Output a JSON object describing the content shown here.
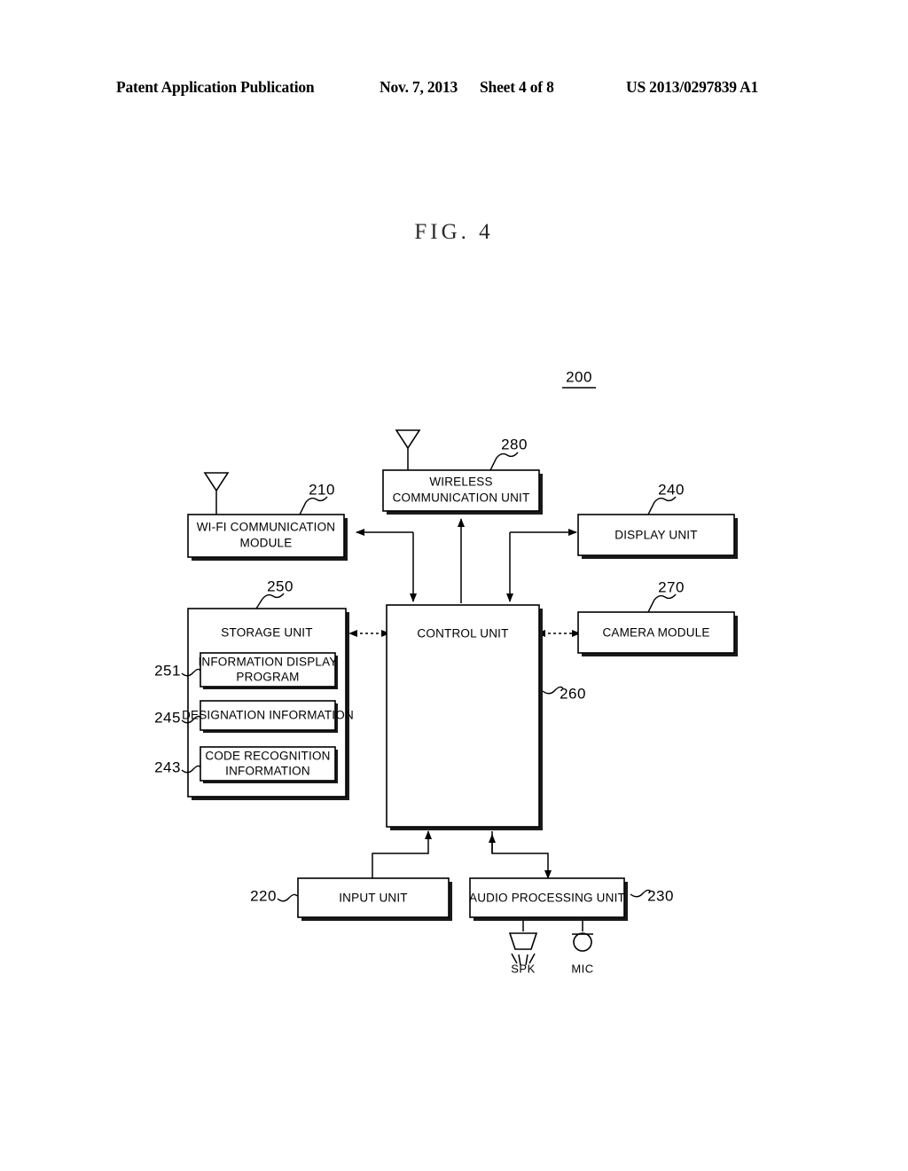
{
  "header": {
    "publication": "Patent Application Publication",
    "date": "Nov. 7, 2013",
    "sheet": "Sheet 4 of 8",
    "patent_number": "US 2013/0297839 A1"
  },
  "figure": {
    "title": "FIG. 4",
    "system_ref": "200"
  },
  "blocks": {
    "wifi": {
      "label_line1": "WI-FI COMMUNICATION",
      "label_line2": "MODULE",
      "ref": "210"
    },
    "wireless": {
      "label_line1": "WIRELESS",
      "label_line2": "COMMUNICATION UNIT",
      "ref": "280"
    },
    "display": {
      "label": "DISPLAY UNIT",
      "ref": "240"
    },
    "storage": {
      "label": "STORAGE UNIT",
      "ref": "250"
    },
    "control": {
      "label": "CONTROL UNIT",
      "ref": "260"
    },
    "camera": {
      "label": "CAMERA MODULE",
      "ref": "270"
    },
    "input": {
      "label": "INPUT UNIT",
      "ref": "220"
    },
    "audio": {
      "label": "AUDIO PROCESSING UNIT",
      "ref": "230"
    }
  },
  "storage_items": [
    {
      "label_line1": "INFORMATION DISPLAY",
      "label_line2": "PROGRAM",
      "ref": "251"
    },
    {
      "label_line1": "DESIGNATION INFORMATION",
      "label_line2": "",
      "ref": "245"
    },
    {
      "label_line1": "CODE RECOGNITION",
      "label_line2": "INFORMATION",
      "ref": "243"
    }
  ],
  "peripherals": [
    {
      "label": "SPK",
      "icon": "speaker-icon"
    },
    {
      "label": "MIC",
      "icon": "microphone-icon"
    }
  ],
  "colors": {
    "ink": "#000000",
    "paper": "#ffffff",
    "shadow": "#1a1a1a"
  }
}
